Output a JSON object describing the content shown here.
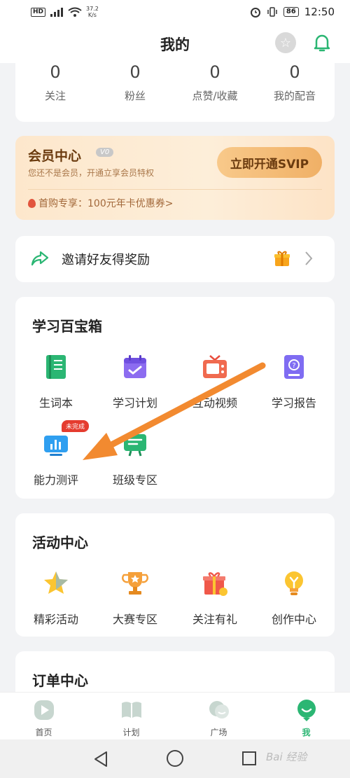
{
  "status_bar": {
    "hd": "HD",
    "network_rate": "37.2",
    "network_unit": "K/s",
    "battery": "86",
    "time": "12:50"
  },
  "header": {
    "title": "我的"
  },
  "stats": [
    {
      "value": "0",
      "label": "关注"
    },
    {
      "value": "0",
      "label": "粉丝"
    },
    {
      "value": "0",
      "label": "点赞/收藏"
    },
    {
      "value": "0",
      "label": "我的配音"
    }
  ],
  "vip": {
    "title": "会员中心",
    "badge": "V0",
    "subtitle": "您还不是会员，开通立享会员特权",
    "button": "立即开通SVIP",
    "coupon": "首购专享：100元年卡优惠券>"
  },
  "invite": {
    "label": "邀请好友得奖励"
  },
  "toolbox": {
    "title": "学习百宝箱",
    "items": [
      {
        "label": "生词本",
        "icon": "vocabulary-book-icon"
      },
      {
        "label": "学习计划",
        "icon": "study-plan-calendar-icon"
      },
      {
        "label": "互动视频",
        "icon": "interactive-video-tv-icon"
      },
      {
        "label": "学习报告",
        "icon": "study-report-icon"
      },
      {
        "label": "能力测评",
        "icon": "ability-assessment-chart-icon"
      },
      {
        "label": "班级专区",
        "icon": "class-zone-icon"
      }
    ],
    "todo_badge": "未完成"
  },
  "activity": {
    "title": "活动中心",
    "items": [
      {
        "label": "精彩活动",
        "icon": "star-icon"
      },
      {
        "label": "大赛专区",
        "icon": "trophy-icon"
      },
      {
        "label": "关注有礼",
        "icon": "gift-box-icon"
      },
      {
        "label": "创作中心",
        "icon": "lightbulb-icon"
      }
    ]
  },
  "orders": {
    "title": "订单中心"
  },
  "tabbar": [
    {
      "label": "首页",
      "icon": "home-play-icon"
    },
    {
      "label": "计划",
      "icon": "plan-book-icon"
    },
    {
      "label": "广场",
      "icon": "square-chat-icon"
    },
    {
      "label": "我",
      "icon": "profile-icon",
      "active": true
    }
  ],
  "watermark": "Bai 经验",
  "colors": {
    "brand_green": "#2bb673",
    "annotation_orange": "#f28a30",
    "vip_brown": "#6b3b0f"
  }
}
